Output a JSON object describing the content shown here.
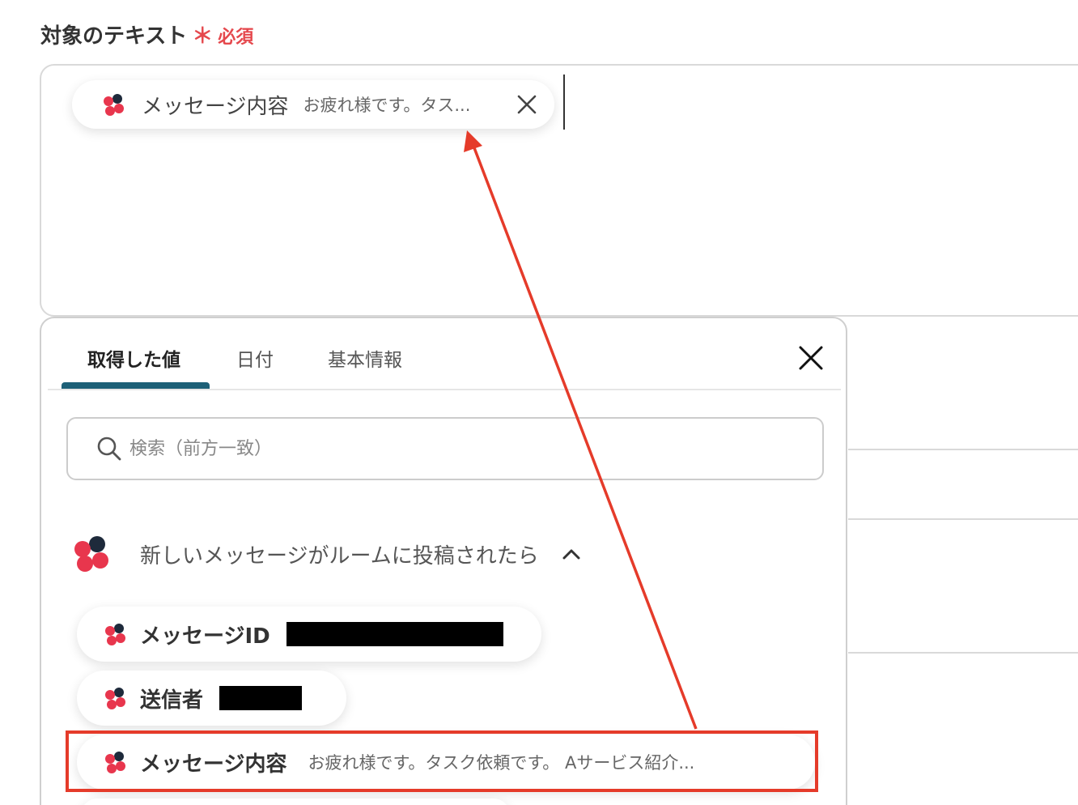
{
  "field": {
    "label": "対象のテキスト",
    "required_mark": "＊",
    "required_text": "必須"
  },
  "selected_chip": {
    "name": "メッセージ内容",
    "preview": "お疲れ様です。タス...",
    "close_icon": "close-icon"
  },
  "panel": {
    "tabs": [
      {
        "label": "取得した値",
        "active": true
      },
      {
        "label": "日付",
        "active": false
      },
      {
        "label": "基本情報",
        "active": false
      }
    ],
    "search": {
      "placeholder": "検索（前方一致）",
      "value": ""
    },
    "group": {
      "title": "新しいメッセージがルームに投稿されたら",
      "expanded": true
    },
    "items": [
      {
        "name": "メッセージID",
        "preview": "",
        "redacted": true
      },
      {
        "name": "送信者",
        "preview": "",
        "redacted": true
      },
      {
        "name": "メッセージ内容",
        "preview": "お疲れ様です。タスク依頼です。 Aサービス紹介...",
        "redacted": false,
        "highlighted": true
      }
    ]
  },
  "colors": {
    "accent": "#1d6077",
    "required": "#e5484d",
    "annotation": "#e53b2a",
    "logo_red": "#e8364d",
    "logo_dark": "#1e2a3b"
  },
  "icons": [
    "app-logo-icon",
    "close-icon",
    "search-icon",
    "chevron-up-icon"
  ]
}
